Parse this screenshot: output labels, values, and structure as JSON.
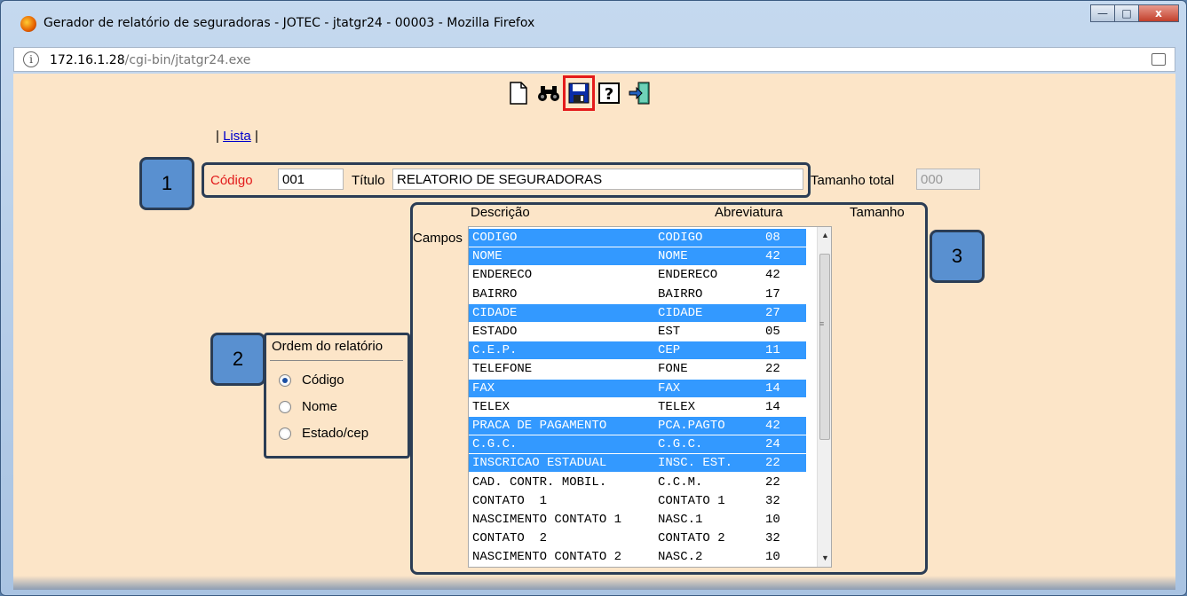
{
  "window": {
    "title": "Gerador de relatório de seguradoras - JOTEC - jtatgr24 - 00003 - Mozilla Firefox",
    "url_host": "172.16.1.28",
    "url_path": "/cgi-bin/jtatgr24.exe",
    "minimize_label": "—",
    "maximize_label": "□",
    "close_label": "x"
  },
  "toolbar": {
    "items": [
      "new-document-icon",
      "search-binoculars-icon",
      "save-disk-icon",
      "help-icon",
      "exit-icon"
    ],
    "highlighted": "save-disk-icon",
    "highlight_color": "#e41b1b"
  },
  "nav": {
    "sep_left": "|",
    "lista_label": "Lista",
    "sep_right": "|"
  },
  "form": {
    "codigo_label": "Código",
    "codigo_value": "001",
    "titulo_label": "Título",
    "titulo_value": "RELATORIO DE SEGURADORAS",
    "tamanho_total_label": "Tamanho total",
    "tamanho_total_value": "000"
  },
  "fields_table": {
    "campos_label": "Campos",
    "headers": {
      "descricao": "Descrição",
      "abreviatura": "Abreviatura",
      "tamanho": "Tamanho"
    },
    "rows": [
      {
        "desc": "CODIGO",
        "abbr": "CODIGO",
        "size": "08",
        "selected": true
      },
      {
        "desc": "NOME",
        "abbr": "NOME",
        "size": "42",
        "selected": true
      },
      {
        "desc": "ENDERECO",
        "abbr": "ENDERECO",
        "size": "42",
        "selected": false
      },
      {
        "desc": "BAIRRO",
        "abbr": "BAIRRO",
        "size": "17",
        "selected": false
      },
      {
        "desc": "CIDADE",
        "abbr": "CIDADE",
        "size": "27",
        "selected": true
      },
      {
        "desc": "ESTADO",
        "abbr": "EST",
        "size": "05",
        "selected": false
      },
      {
        "desc": "C.E.P.",
        "abbr": "CEP",
        "size": "11",
        "selected": true
      },
      {
        "desc": "TELEFONE",
        "abbr": "FONE",
        "size": "22",
        "selected": false
      },
      {
        "desc": "FAX",
        "abbr": "FAX",
        "size": "14",
        "selected": true
      },
      {
        "desc": "TELEX",
        "abbr": "TELEX",
        "size": "14",
        "selected": false
      },
      {
        "desc": "PRACA DE PAGAMENTO",
        "abbr": "PCA.PAGTO",
        "size": "42",
        "selected": true
      },
      {
        "desc": "C.G.C.",
        "abbr": "C.G.C.",
        "size": "24",
        "selected": true
      },
      {
        "desc": "INSCRICAO ESTADUAL",
        "abbr": "INSC. EST.",
        "size": "22",
        "selected": true
      },
      {
        "desc": "CAD. CONTR. MOBIL.",
        "abbr": "C.C.M.",
        "size": "22",
        "selected": false
      },
      {
        "desc": "CONTATO  1",
        "abbr": "CONTATO 1",
        "size": "32",
        "selected": false
      },
      {
        "desc": "NASCIMENTO CONTATO 1",
        "abbr": "NASC.1",
        "size": "10",
        "selected": false
      },
      {
        "desc": "CONTATO  2",
        "abbr": "CONTATO 2",
        "size": "32",
        "selected": false
      },
      {
        "desc": "NASCIMENTO CONTATO 2",
        "abbr": "NASC.2",
        "size": "10",
        "selected": false
      }
    ],
    "selected_color": "#3399ff"
  },
  "order": {
    "title": "Ordem do relatório",
    "options": [
      "Código",
      "Nome",
      "Estado/cep"
    ],
    "selected": "Código"
  },
  "callouts": [
    "1",
    "2",
    "3"
  ],
  "callout_color": "#5990d0"
}
